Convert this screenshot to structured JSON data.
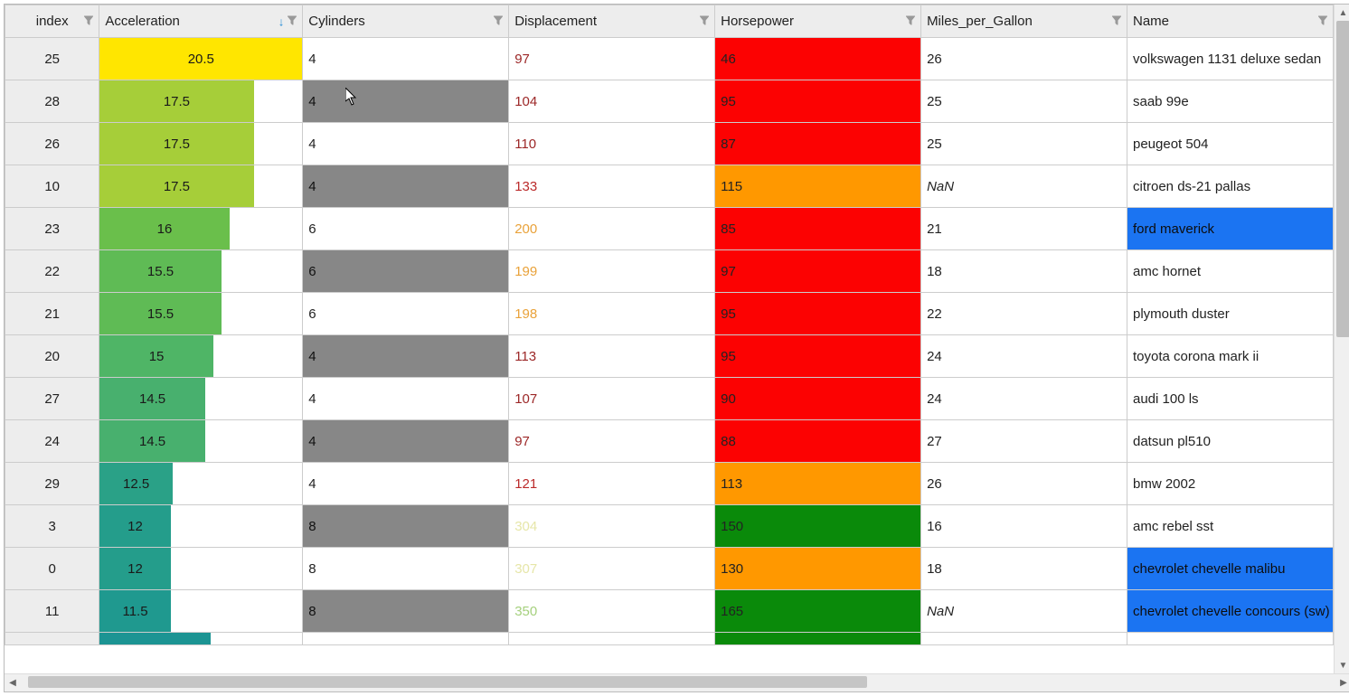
{
  "columns": {
    "index": "index",
    "acceleration": "Acceleration",
    "cylinders": "Cylinders",
    "displacement": "Displacement",
    "horsepower": "Horsepower",
    "mpg": "Miles_per_Gallon",
    "name": "Name"
  },
  "sort": {
    "column": "Acceleration",
    "direction": "desc"
  },
  "accel_range": {
    "min": 8,
    "max": 20.5
  },
  "rows": [
    {
      "index": 25,
      "accel": 20.5,
      "accel_color": "#ffe600",
      "cyl": 4,
      "cyl_grey": false,
      "disp": 97,
      "disp_class": "disp-darkred",
      "hp": 46,
      "hp_class": "hp-red",
      "mpg": "26",
      "name": "volkswagen 1131 deluxe sedan",
      "name_blue": false
    },
    {
      "index": 28,
      "accel": 17.5,
      "accel_color": "#a6ce39",
      "cyl": 4,
      "cyl_grey": true,
      "disp": 104,
      "disp_class": "disp-darkred",
      "hp": 95,
      "hp_class": "hp-red",
      "mpg": "25",
      "name": "saab 99e",
      "name_blue": false
    },
    {
      "index": 26,
      "accel": 17.5,
      "accel_color": "#a6ce39",
      "cyl": 4,
      "cyl_grey": false,
      "disp": 110,
      "disp_class": "disp-darkred",
      "hp": 87,
      "hp_class": "hp-red",
      "mpg": "25",
      "name": "peugeot 504",
      "name_blue": false
    },
    {
      "index": 10,
      "accel": 17.5,
      "accel_color": "#a6ce39",
      "cyl": 4,
      "cyl_grey": true,
      "disp": 133,
      "disp_class": "disp-red",
      "hp": 115,
      "hp_class": "hp-orange",
      "mpg": "NaN",
      "name": "citroen ds-21 pallas",
      "name_blue": false
    },
    {
      "index": 23,
      "accel": 16,
      "accel_color": "#6abf4b",
      "cyl": 6,
      "cyl_grey": false,
      "disp": 200,
      "disp_class": "disp-orange",
      "hp": 85,
      "hp_class": "hp-red",
      "mpg": "21",
      "name": "ford maverick",
      "name_blue": true
    },
    {
      "index": 22,
      "accel": 15.5,
      "accel_color": "#5fbb55",
      "cyl": 6,
      "cyl_grey": true,
      "disp": 199,
      "disp_class": "disp-orange",
      "hp": 97,
      "hp_class": "hp-red",
      "mpg": "18",
      "name": "amc hornet",
      "name_blue": false
    },
    {
      "index": 21,
      "accel": 15.5,
      "accel_color": "#5fbb55",
      "cyl": 6,
      "cyl_grey": false,
      "disp": 198,
      "disp_class": "disp-orange",
      "hp": 95,
      "hp_class": "hp-red",
      "mpg": "22",
      "name": "plymouth duster",
      "name_blue": false
    },
    {
      "index": 20,
      "accel": 15,
      "accel_color": "#4fb566",
      "cyl": 4,
      "cyl_grey": true,
      "disp": 113,
      "disp_class": "disp-darkred",
      "hp": 95,
      "hp_class": "hp-red",
      "mpg": "24",
      "name": "toyota corona mark ii",
      "name_blue": false
    },
    {
      "index": 27,
      "accel": 14.5,
      "accel_color": "#48b06e",
      "cyl": 4,
      "cyl_grey": false,
      "disp": 107,
      "disp_class": "disp-darkred",
      "hp": 90,
      "hp_class": "hp-red",
      "mpg": "24",
      "name": "audi 100 ls",
      "name_blue": false
    },
    {
      "index": 24,
      "accel": 14.5,
      "accel_color": "#48b06e",
      "cyl": 4,
      "cyl_grey": true,
      "disp": 97,
      "disp_class": "disp-darkred",
      "hp": 88,
      "hp_class": "hp-red",
      "mpg": "27",
      "name": "datsun pl510",
      "name_blue": false
    },
    {
      "index": 29,
      "accel": 12.5,
      "accel_color": "#2aa187",
      "cyl": 4,
      "cyl_grey": false,
      "disp": 121,
      "disp_class": "disp-red",
      "hp": 113,
      "hp_class": "hp-orange",
      "mpg": "26",
      "name": "bmw 2002",
      "name_blue": false
    },
    {
      "index": 3,
      "accel": 12,
      "accel_color": "#249d8b",
      "cyl": 8,
      "cyl_grey": true,
      "disp": 304,
      "disp_class": "disp-yellow",
      "hp": 150,
      "hp_class": "hp-green",
      "mpg": "16",
      "name": "amc rebel sst",
      "name_blue": false
    },
    {
      "index": 0,
      "accel": 12,
      "accel_color": "#249d8b",
      "cyl": 8,
      "cyl_grey": false,
      "disp": 307,
      "disp_class": "disp-yellow",
      "hp": 130,
      "hp_class": "hp-orange",
      "mpg": "18",
      "name": "chevrolet chevelle malibu",
      "name_blue": true
    },
    {
      "index": 11,
      "accel": 11.5,
      "accel_color": "#1f998f",
      "cyl": 8,
      "cyl_grey": true,
      "disp": 350,
      "disp_class": "disp-ltgreen",
      "hp": 165,
      "hp_class": "hp-green",
      "mpg": "NaN",
      "name": "chevrolet chevelle concours (sw)",
      "name_blue": true
    }
  ],
  "partial_row": {
    "accel_color": "#1c9493",
    "hp_class": "hp-green"
  }
}
